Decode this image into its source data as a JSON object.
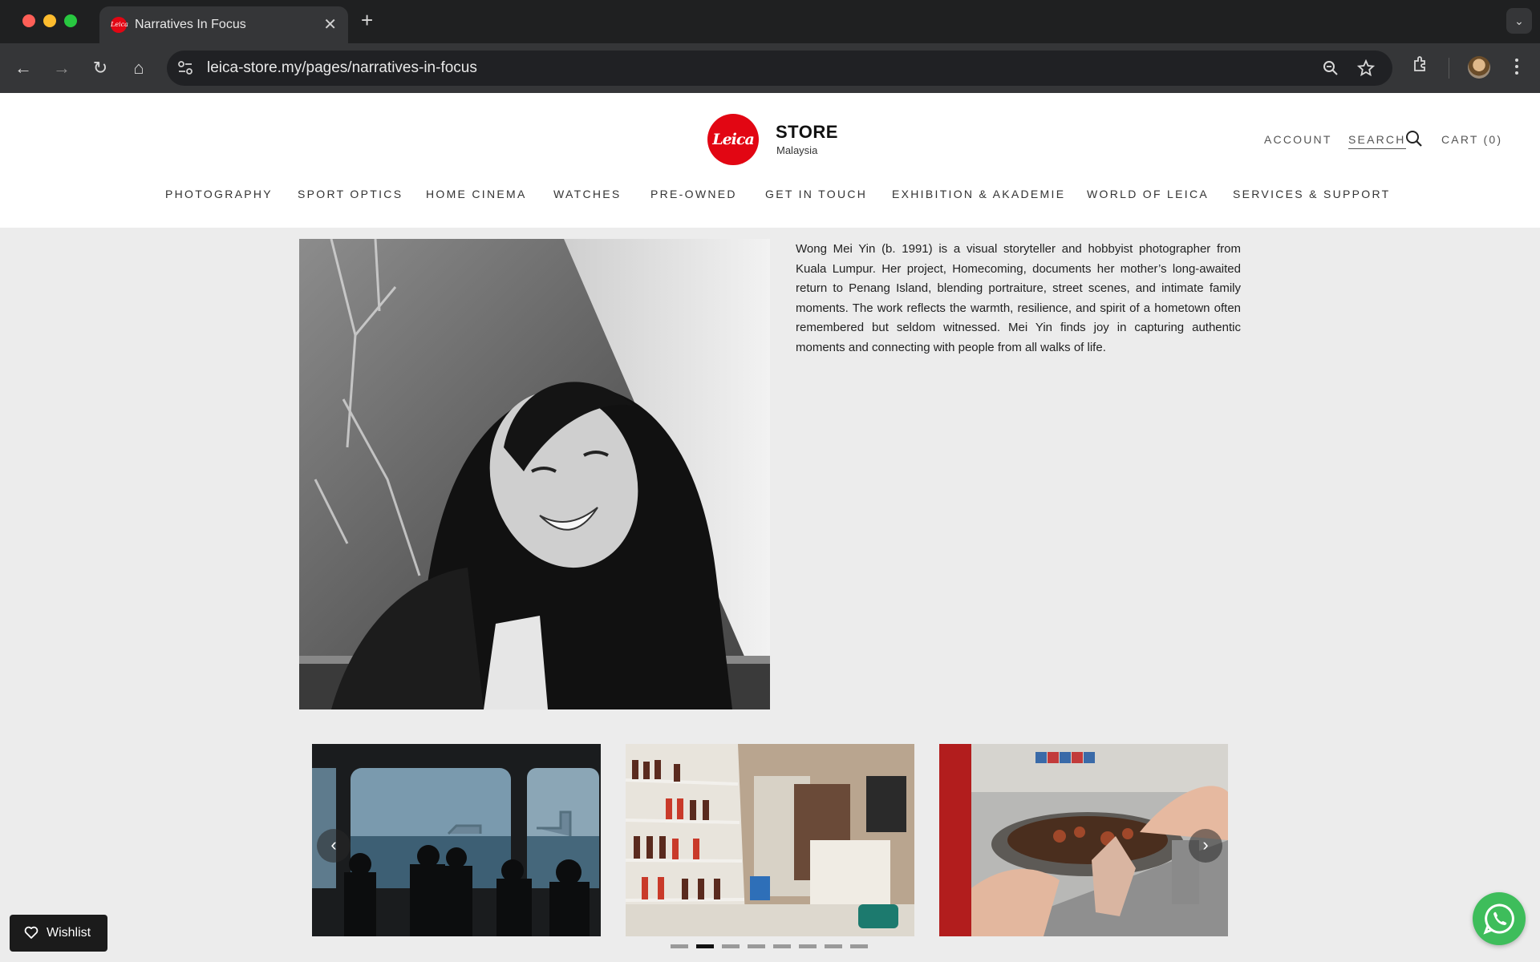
{
  "browser": {
    "tab_title": "Narratives In Focus",
    "favicon_text": "Leica",
    "tab_close": "✕",
    "new_tab": "+",
    "tab_menu": "⌄",
    "url": "leica-store.my/pages/narratives-in-focus",
    "nav": {
      "back": "←",
      "forward": "→",
      "reload": "↻",
      "home": "⌂"
    },
    "icons": [
      "site-info-icon",
      "zoom-icon",
      "bookmark-star-icon",
      "extensions-icon",
      "profile-avatar",
      "more-menu-icon"
    ]
  },
  "header": {
    "logo_text": "Leica",
    "store_title": "STORE",
    "store_subtitle": "Malaysia",
    "account": "ACCOUNT",
    "search": "SEARCH",
    "cart": "CART (0)",
    "brand_color": "#e20613"
  },
  "nav": {
    "items": [
      "PHOTOGRAPHY",
      "SPORT OPTICS",
      "HOME CINEMA",
      "WATCHES",
      "PRE-OWNED",
      "GET IN TOUCH",
      "EXHIBITION & AKADEMIE",
      "WORLD OF LEICA",
      "SERVICES & SUPPORT"
    ]
  },
  "bio": {
    "text": "Wong Mei Yin (b. 1991) is a visual storyteller and hobbyist photographer from Kuala Lumpur. Her project, Homecoming, documents her mother’s long-awaited return to Penang Island, blending portraiture, street scenes, and intimate family moments. The work reflects the warmth, resilience, and spirit of a hometown often remembered but seldom witnessed. Mei Yin finds joy in capturing authentic moments and connecting with people from all walks of life."
  },
  "carousel": {
    "prev": "‹",
    "next": "›",
    "slide_count": 8,
    "active_index": 1
  },
  "wishlist": {
    "label": "Wishlist"
  },
  "whatsapp_color": "#3ebd5b"
}
